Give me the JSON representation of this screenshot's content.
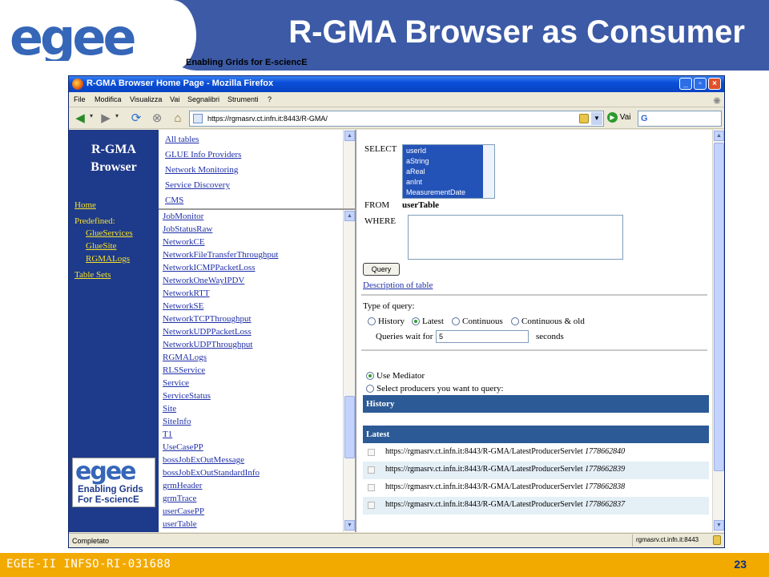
{
  "slide": {
    "title": "R-GMA Browser as Consumer",
    "subtitle": "Enabling Grids for E-sciencE",
    "logo_text": "egee",
    "footer": "EGEE-II INFSO-RI-031688",
    "page_number": "23"
  },
  "browser": {
    "window_title": "R-GMA Browser Home Page - Mozilla Firefox",
    "menu": [
      "File",
      "Modifica",
      "Visualizza",
      "Vai",
      "Segnalibri",
      "Strumenti",
      "?"
    ],
    "url": "https://rgmasrv.ct.infn.it:8443/R-GMA/",
    "go_label": "Vai",
    "status_text": "Completato",
    "status_host": "rgmasrv.ct.infn.it:8443"
  },
  "nav": {
    "title_line1": "R-GMA",
    "title_line2": "Browser",
    "home": "Home",
    "predefined": "Predefined:",
    "predefined_items": [
      "GlueServices",
      "GlueSite",
      "RGMALogs"
    ],
    "table_sets": "Table Sets",
    "logo_word": "egee",
    "logo_line1": "Enabling Grids",
    "logo_line2": "For E-sciencE"
  },
  "top_links": [
    "All tables",
    "GLUE Info Providers",
    "Network Monitoring",
    "Service Discovery",
    "CMS"
  ],
  "tables": [
    "JobMonitor",
    "JobStatusRaw",
    "NetworkCE",
    "NetworkFileTransferThroughput",
    "NetworkICMPPacketLoss",
    "NetworkOneWayIPDV",
    "NetworkRTT",
    "NetworkSE",
    "NetworkTCPThroughput",
    "NetworkUDPPacketLoss",
    "NetworkUDPThroughput",
    "RGMALogs",
    "RLSService",
    "Service",
    "ServiceStatus",
    "Site",
    "SiteInfo",
    "T1",
    "UseCasePP",
    "bossJobExOutMessage",
    "bossJobExOutStandardInfo",
    "grmHeader",
    "grmTrace",
    "userCasePP",
    "userTable"
  ],
  "query": {
    "select_label": "SELECT",
    "select_options": [
      "userId",
      "aString",
      "aReal",
      "anInt",
      "MeasurementDate"
    ],
    "from_label": "FROM",
    "from_value": "userTable",
    "where_label": "WHERE",
    "query_button": "Query",
    "description_link": "Description of table",
    "type_label": "Type of query:",
    "types": [
      "History",
      "Latest",
      "Continuous",
      "Continuous & old"
    ],
    "selected_type": "Latest",
    "wait_label": "Queries wait for",
    "wait_value": "5",
    "wait_unit": "seconds",
    "use_mediator": "Use Mediator",
    "select_producers": "Select producers you want to query:",
    "history_header": "History",
    "latest_header": "Latest",
    "producers": [
      {
        "url": "https://rgmasrv.ct.infn.it:8443/R-GMA/LatestProducerServlet",
        "id": "1778662840"
      },
      {
        "url": "https://rgmasrv.ct.infn.it:8443/R-GMA/LatestProducerServlet",
        "id": "1778662839"
      },
      {
        "url": "https://rgmasrv.ct.infn.it:8443/R-GMA/LatestProducerServlet",
        "id": "1778662838"
      },
      {
        "url": "https://rgmasrv.ct.infn.it:8443/R-GMA/LatestProducerServlet",
        "id": "1778662837"
      }
    ]
  },
  "colors": {
    "header_blue": "#3c5aa6",
    "footer_orange": "#f2a900",
    "nav_panel": "#1e3a8a",
    "nav_link": "#f5e12a",
    "section_head": "#2c5a96"
  }
}
